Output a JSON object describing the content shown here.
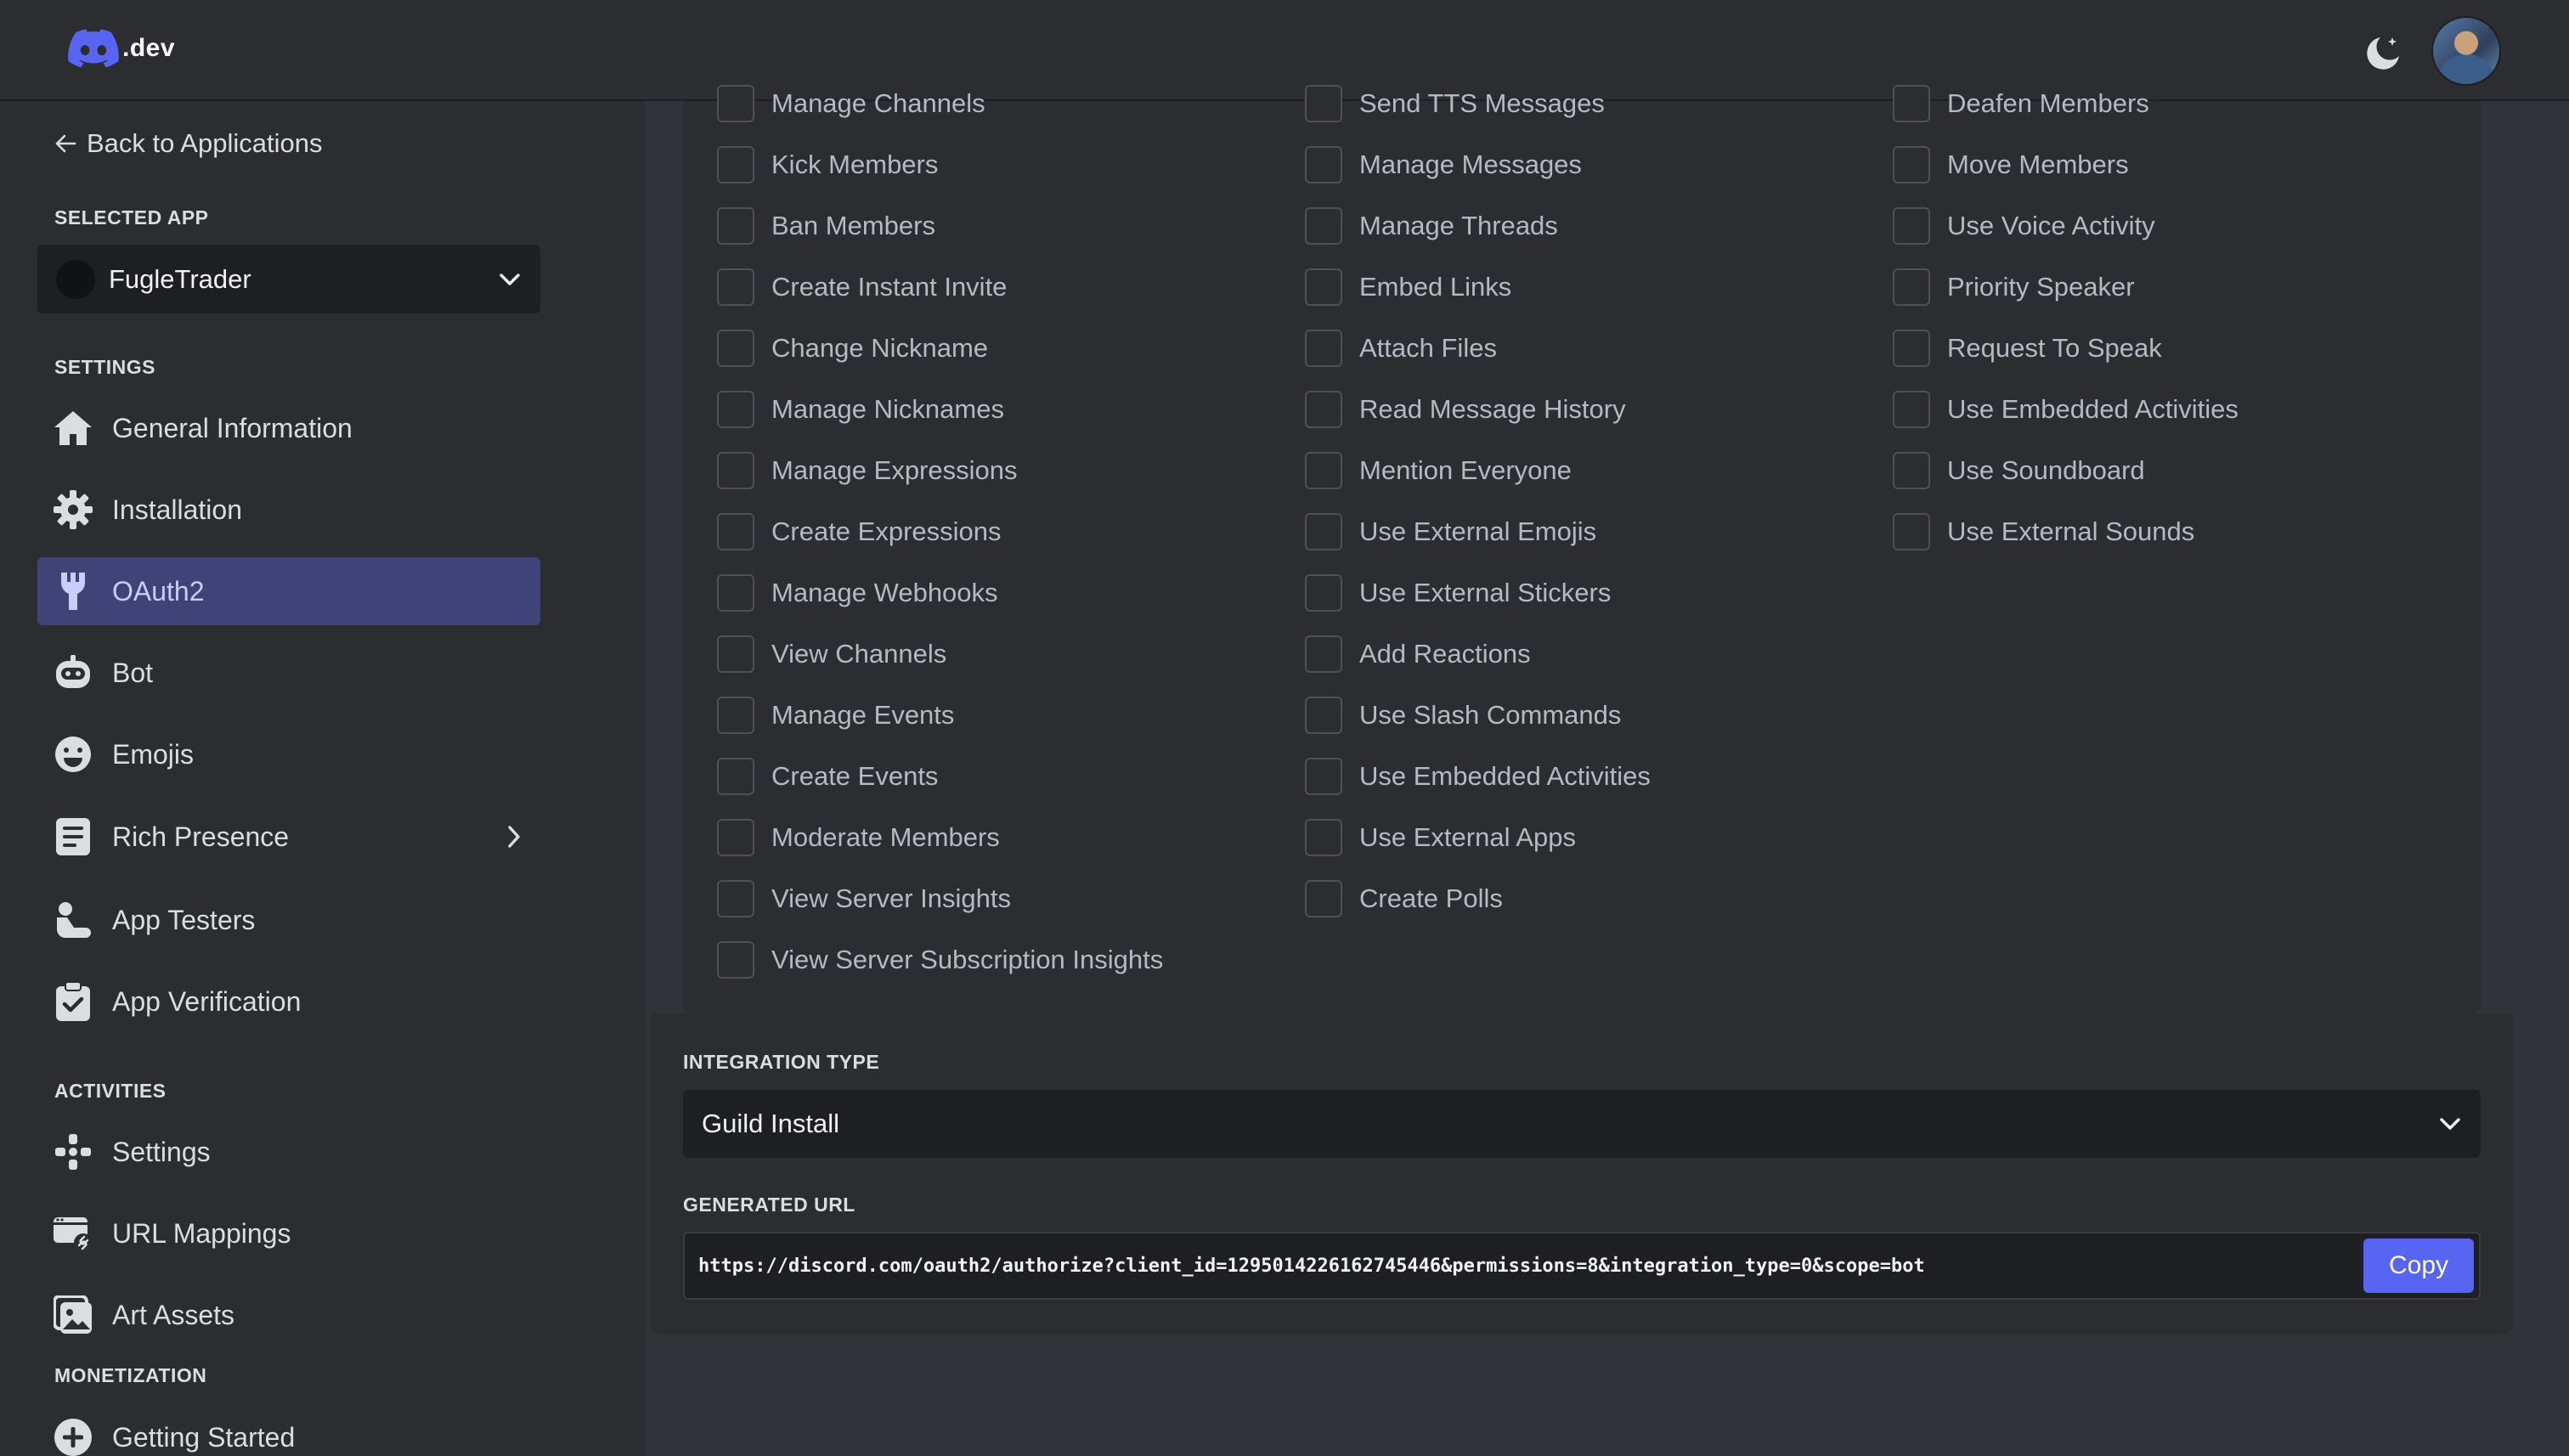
{
  "topbar": {
    "logo_text": ".dev"
  },
  "sidebar": {
    "back_label": "Back to Applications",
    "selected_app_label": "SELECTED APP",
    "selected_app_name": "FugleTrader",
    "settings_label": "SETTINGS",
    "settings_items": [
      {
        "label": "General Information",
        "icon": "home-icon"
      },
      {
        "label": "Installation",
        "icon": "gear-icon"
      },
      {
        "label": "OAuth2",
        "icon": "wrench-icon",
        "active": true
      },
      {
        "label": "Bot",
        "icon": "bot-icon"
      },
      {
        "label": "Emojis",
        "icon": "emoji-icon"
      },
      {
        "label": "Rich Presence",
        "icon": "document-icon"
      },
      {
        "label": "App Testers",
        "icon": "testers-icon"
      },
      {
        "label": "App Verification",
        "icon": "clipboard-check-icon"
      }
    ],
    "activities_label": "ACTIVITIES",
    "activities_items": [
      {
        "label": "Settings",
        "icon": "gamepad-icon"
      },
      {
        "label": "URL Mappings",
        "icon": "url-mappings-icon"
      },
      {
        "label": "Art Assets",
        "icon": "image-icon"
      }
    ],
    "monetization_label": "MONETIZATION",
    "monetization_items": [
      {
        "label": "Getting Started",
        "icon": "plus-circle-icon"
      }
    ]
  },
  "permissions": {
    "col1": [
      "Manage Channels",
      "Kick Members",
      "Ban Members",
      "Create Instant Invite",
      "Change Nickname",
      "Manage Nicknames",
      "Manage Expressions",
      "Create Expressions",
      "Manage Webhooks",
      "View Channels",
      "Manage Events",
      "Create Events",
      "Moderate Members",
      "View Server Insights",
      "View Server Subscription Insights"
    ],
    "col2": [
      "Send TTS Messages",
      "Manage Messages",
      "Manage Threads",
      "Embed Links",
      "Attach Files",
      "Read Message History",
      "Mention Everyone",
      "Use External Emojis",
      "Use External Stickers",
      "Add Reactions",
      "Use Slash Commands",
      "Use Embedded Activities",
      "Use External Apps",
      "Create Polls"
    ],
    "col3": [
      "Deafen Members",
      "Move Members",
      "Use Voice Activity",
      "Priority Speaker",
      "Request To Speak",
      "Use Embedded Activities",
      "Use Soundboard",
      "Use External Sounds"
    ]
  },
  "integration": {
    "label": "INTEGRATION TYPE",
    "value": "Guild Install"
  },
  "generated": {
    "label": "GENERATED URL",
    "url": "https://discord.com/oauth2/authorize?client_id=1295014226162745446&permissions=8&integration_type=0&scope=bot",
    "copy_label": "Copy"
  },
  "colors": {
    "accent": "#5865f2",
    "active_nav": "#3f4378",
    "background": "#313338",
    "panel": "#2b2d31"
  }
}
